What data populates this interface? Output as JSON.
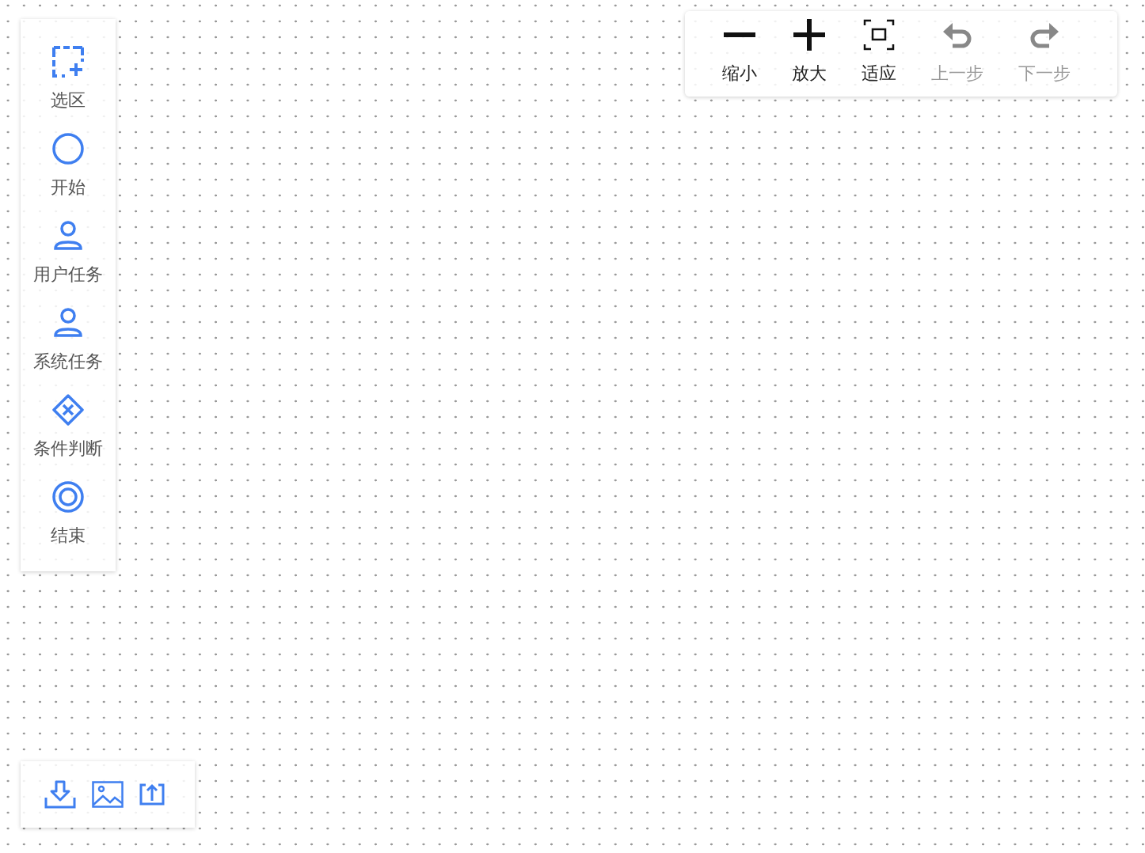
{
  "palette": [
    {
      "kind": "selection",
      "label": "选区"
    },
    {
      "kind": "start",
      "label": "开始"
    },
    {
      "kind": "user",
      "label": "用户任务"
    },
    {
      "kind": "system",
      "label": "系统任务"
    },
    {
      "kind": "gateway",
      "label": "条件判断"
    },
    {
      "kind": "end",
      "label": "结束"
    }
  ],
  "toolbar": [
    {
      "kind": "zoom-out",
      "label": "缩小",
      "disabled": false
    },
    {
      "kind": "zoom-in",
      "label": "放大",
      "disabled": false
    },
    {
      "kind": "fit",
      "label": "适应",
      "disabled": false
    },
    {
      "kind": "undo",
      "label": "上一步",
      "disabled": true
    },
    {
      "kind": "redo",
      "label": "下一步",
      "disabled": true
    }
  ],
  "file_actions": [
    {
      "kind": "download"
    },
    {
      "kind": "image"
    },
    {
      "kind": "upload"
    }
  ]
}
